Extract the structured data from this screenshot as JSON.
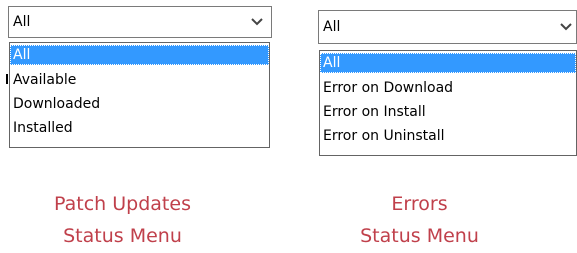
{
  "patch_updates": {
    "selected_value": "All",
    "options": [
      "All",
      "Available",
      "Downloaded",
      "Installed"
    ],
    "highlighted_option": "All",
    "caption_line1": "Patch Updates",
    "caption_line2": "Status Menu"
  },
  "errors": {
    "selected_value": "All",
    "options": [
      "All",
      "Error on Download",
      "Error on Install",
      "Error on Uninstall"
    ],
    "highlighted_option": "All",
    "caption_line1": "Errors",
    "caption_line2": "Status Menu"
  },
  "icons": {
    "dropdown_arrow": "chevron-down-icon"
  },
  "colors": {
    "highlight": "#3399ff",
    "caption": "#c0404b"
  }
}
